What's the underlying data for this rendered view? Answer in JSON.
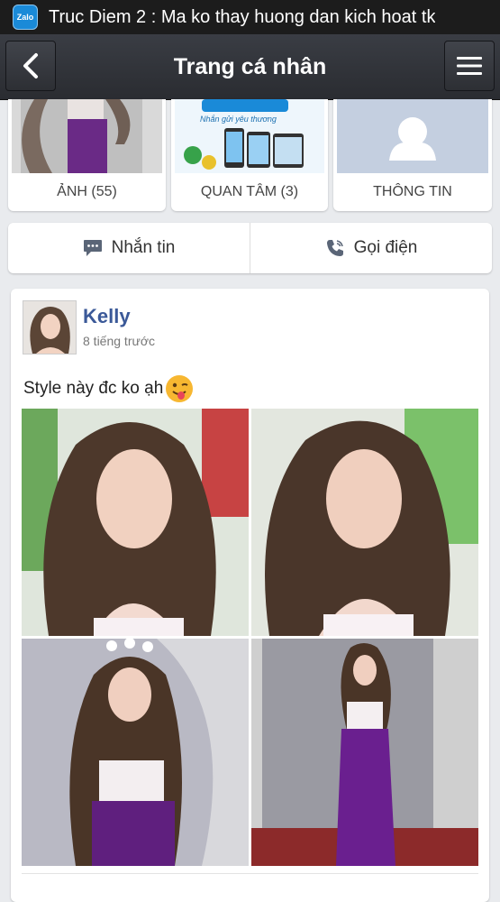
{
  "notification": {
    "app_icon": "zalo-icon",
    "app_icon_label": "Zalo",
    "text": "Truc Diem 2 : Ma ko thay huong dan kich hoat tk"
  },
  "actionbar": {
    "title": "Trang cá nhân",
    "back_icon": "back-arrow-icon",
    "menu_icon": "hamburger-menu-icon"
  },
  "tiles": [
    {
      "label": "ẢNH (55)"
    },
    {
      "label": "QUAN TÂM (3)",
      "banner_text": "Nhắn gửi yêu thương"
    },
    {
      "label": "THÔNG TIN"
    }
  ],
  "actions": {
    "message_label": "Nhắn tin",
    "call_label": "Gọi điện"
  },
  "post": {
    "author": "Kelly",
    "time": "8 tiếng trước",
    "caption": "Style này đc ko ạh"
  },
  "colors": {
    "accent": "#3b5998",
    "actionbar": "#33363c",
    "background": "#e9ebee"
  }
}
